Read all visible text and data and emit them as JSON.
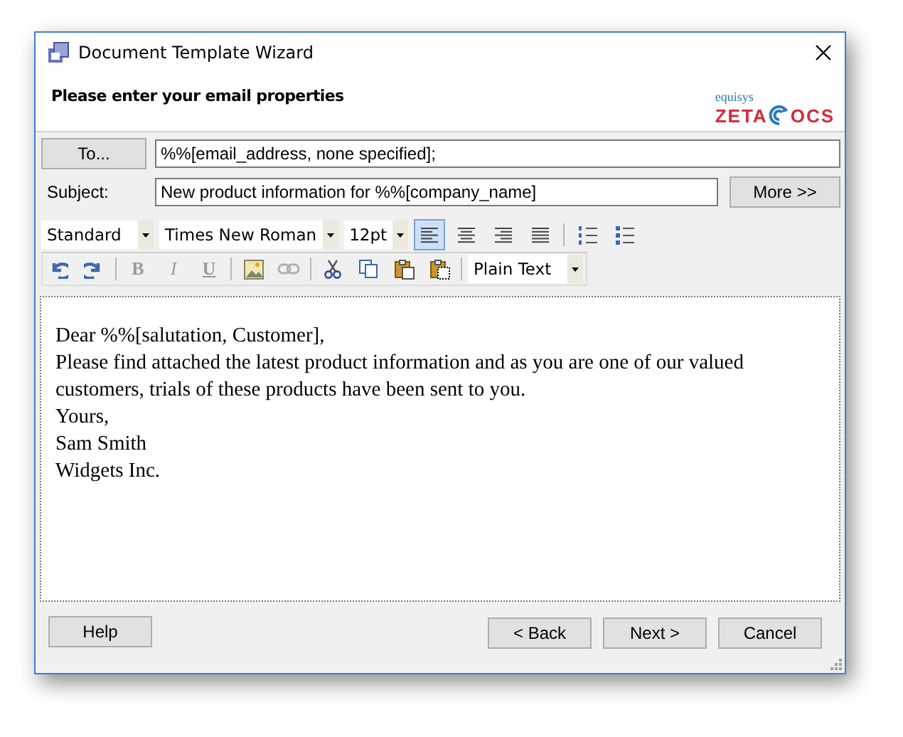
{
  "window": {
    "title": "Document Template Wizard"
  },
  "header": {
    "heading": "Please enter your email properties",
    "logo": {
      "tagline": "equisys",
      "left": "ZETA",
      "right": "OCS"
    }
  },
  "to": {
    "button": "To...",
    "value": "%%[email_address, none specified];"
  },
  "subject": {
    "label": "Subject:",
    "value": "New product information for %%[company_name]",
    "more_button": "More >>"
  },
  "format_bar": {
    "style": "Standard",
    "font": "Times New Roman",
    "size": "12pt",
    "alignment": [
      {
        "selected": true
      },
      {
        "selected": false
      },
      {
        "selected": false
      },
      {
        "selected": false
      }
    ]
  },
  "edit_bar": {
    "style_buttons": [
      {
        "label": "B",
        "disabled": true
      },
      {
        "label": "I",
        "disabled": true
      },
      {
        "label": "U",
        "disabled": true
      }
    ],
    "link_disabled": true,
    "text_format": "Plain Text"
  },
  "editor": {
    "lines": [
      "Dear %%[salutation, Customer],",
      "Please find attached the latest product information and as you are one of our valued customers, trials of these products have been sent to you.",
      "Yours,",
      "Sam Smith",
      "Widgets Inc."
    ]
  },
  "buttons": {
    "help": "Help",
    "back": "< Back",
    "next": "Next >",
    "cancel": "Cancel"
  }
}
